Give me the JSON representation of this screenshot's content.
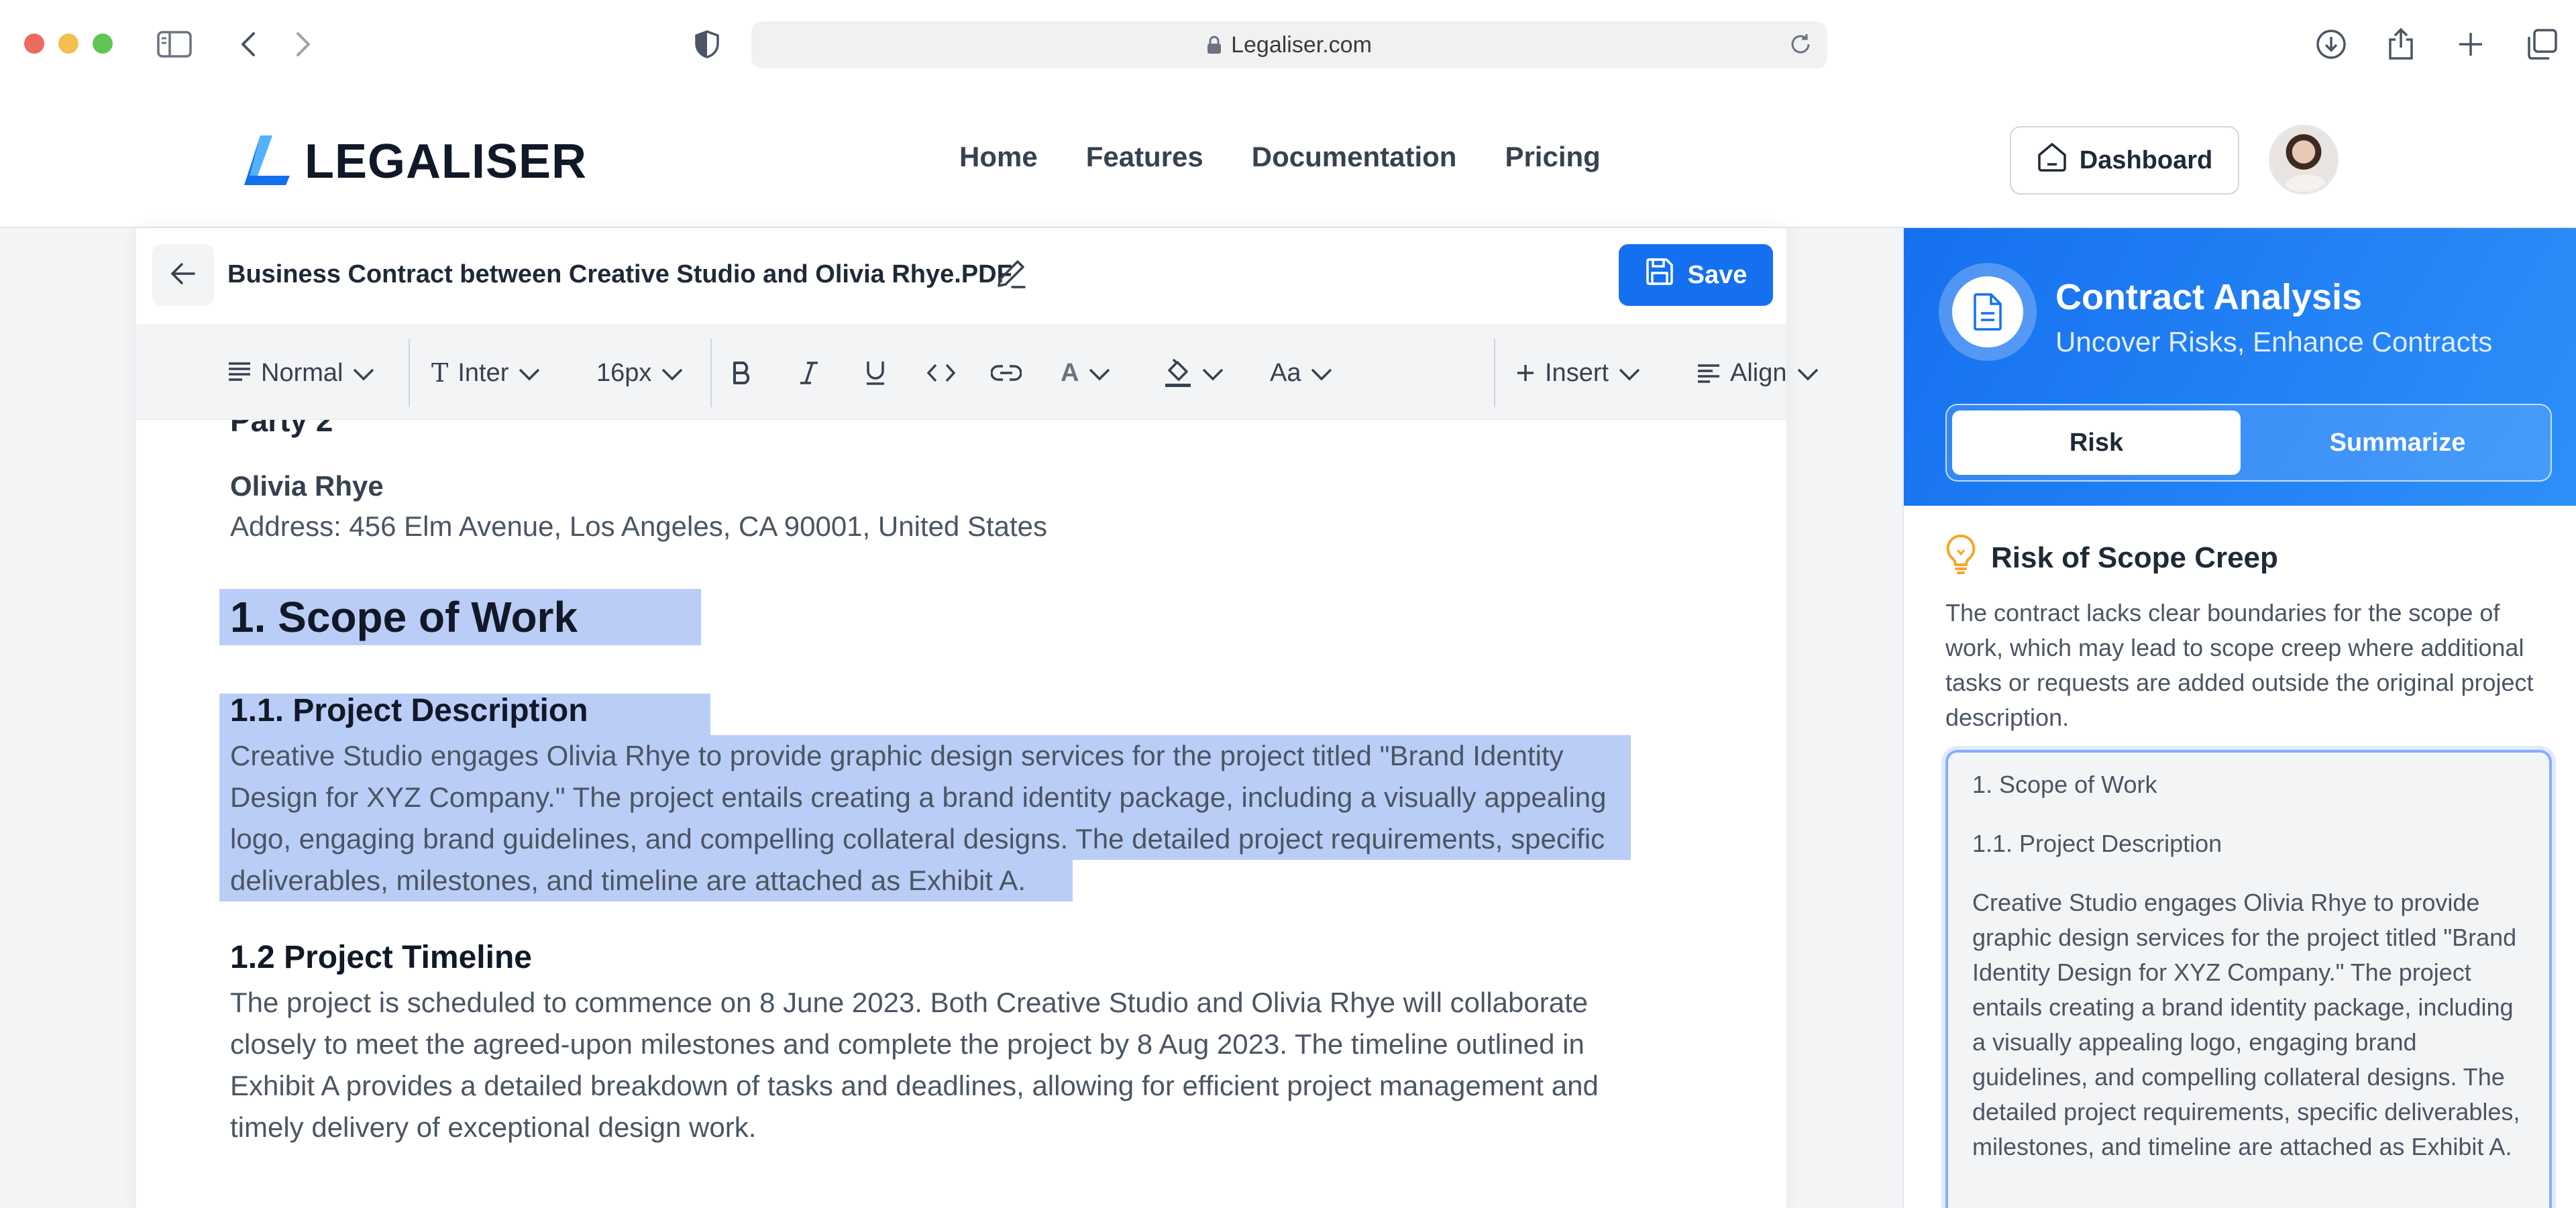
{
  "browser": {
    "url": "Legaliser.com"
  },
  "header": {
    "logo_text": "LEGALISER",
    "nav": [
      "Home",
      "Features",
      "Documentation",
      "Pricing"
    ],
    "dashboard_label": "Dashboard"
  },
  "editor": {
    "doc_title": "Business Contract between Creative Studio and Olivia Rhye.PDF",
    "save_label": "Save",
    "toolbar": {
      "style": "Normal",
      "font": "Inter",
      "size": "16px",
      "color_letter": "A",
      "case_label": "Aa",
      "insert_label": "Insert",
      "align_label": "Align",
      "text_icon_letter": "T"
    },
    "content": {
      "party2": "Party 2",
      "name": "Olivia Rhye",
      "address": "Address: 456 Elm Avenue, Los Angeles, CA 90001, United States",
      "h1": "1. Scope of Work",
      "h2_1": "1.1. Project Description",
      "p1_lines": [
        "Creative Studio engages Olivia Rhye to provide graphic design services for the project titled \"Brand Identity",
        "Design for XYZ Company.\" The project entails creating a brand identity package, including a visually appealing",
        "logo, engaging brand guidelines, and compelling collateral designs. The detailed project requirements, specific",
        "deliverables, milestones, and timeline are attached as Exhibit A."
      ],
      "h2_2": "1.2 Project Timeline",
      "p2_lines": [
        "The project is scheduled to commence on 8 June 2023. Both Creative Studio and Olivia Rhye will collaborate",
        "closely to meet the agreed-upon milestones and complete the project by 8 Aug 2023. The timeline outlined in",
        "Exhibit A provides a detailed breakdown of tasks and deadlines, allowing for efficient project management and",
        "timely delivery of exceptional design work."
      ]
    }
  },
  "panel": {
    "title": "Contract Analysis",
    "subtitle": "Uncover Risks, Enhance Contracts",
    "tabs": [
      "Risk",
      "Summarize"
    ],
    "risk_title": "Risk of Scope Creep",
    "risk_desc": "The contract lacks clear boundaries for the scope of work, which may lead to scope creep where additional tasks or requests are added outside the original project description.",
    "quote": {
      "line1": "1. Scope of Work",
      "line2": "1.1. Project Description",
      "line3": "Creative Studio engages Olivia Rhye to provide graphic design services for the project titled \"Brand Identity Design for XYZ Company.\" The project entails creating a brand identity package, including a visually appealing logo, engaging brand guidelines, and compelling collateral designs. The detailed project requirements, specific deliverables, milestones, and timeline are attached as Exhibit A."
    }
  },
  "colors": {
    "accent": "#1570ef",
    "highlight": "#b9cdf6"
  },
  "icons": [
    "sidebar-icon",
    "chevron-left-icon",
    "chevron-right-icon",
    "shield-icon",
    "lock-icon",
    "reload-icon",
    "download-icon",
    "share-icon",
    "plus-icon",
    "tabs-icon",
    "home-icon",
    "arrow-left-icon",
    "pencil-icon",
    "save-icon",
    "document-icon",
    "lightbulb-icon"
  ]
}
